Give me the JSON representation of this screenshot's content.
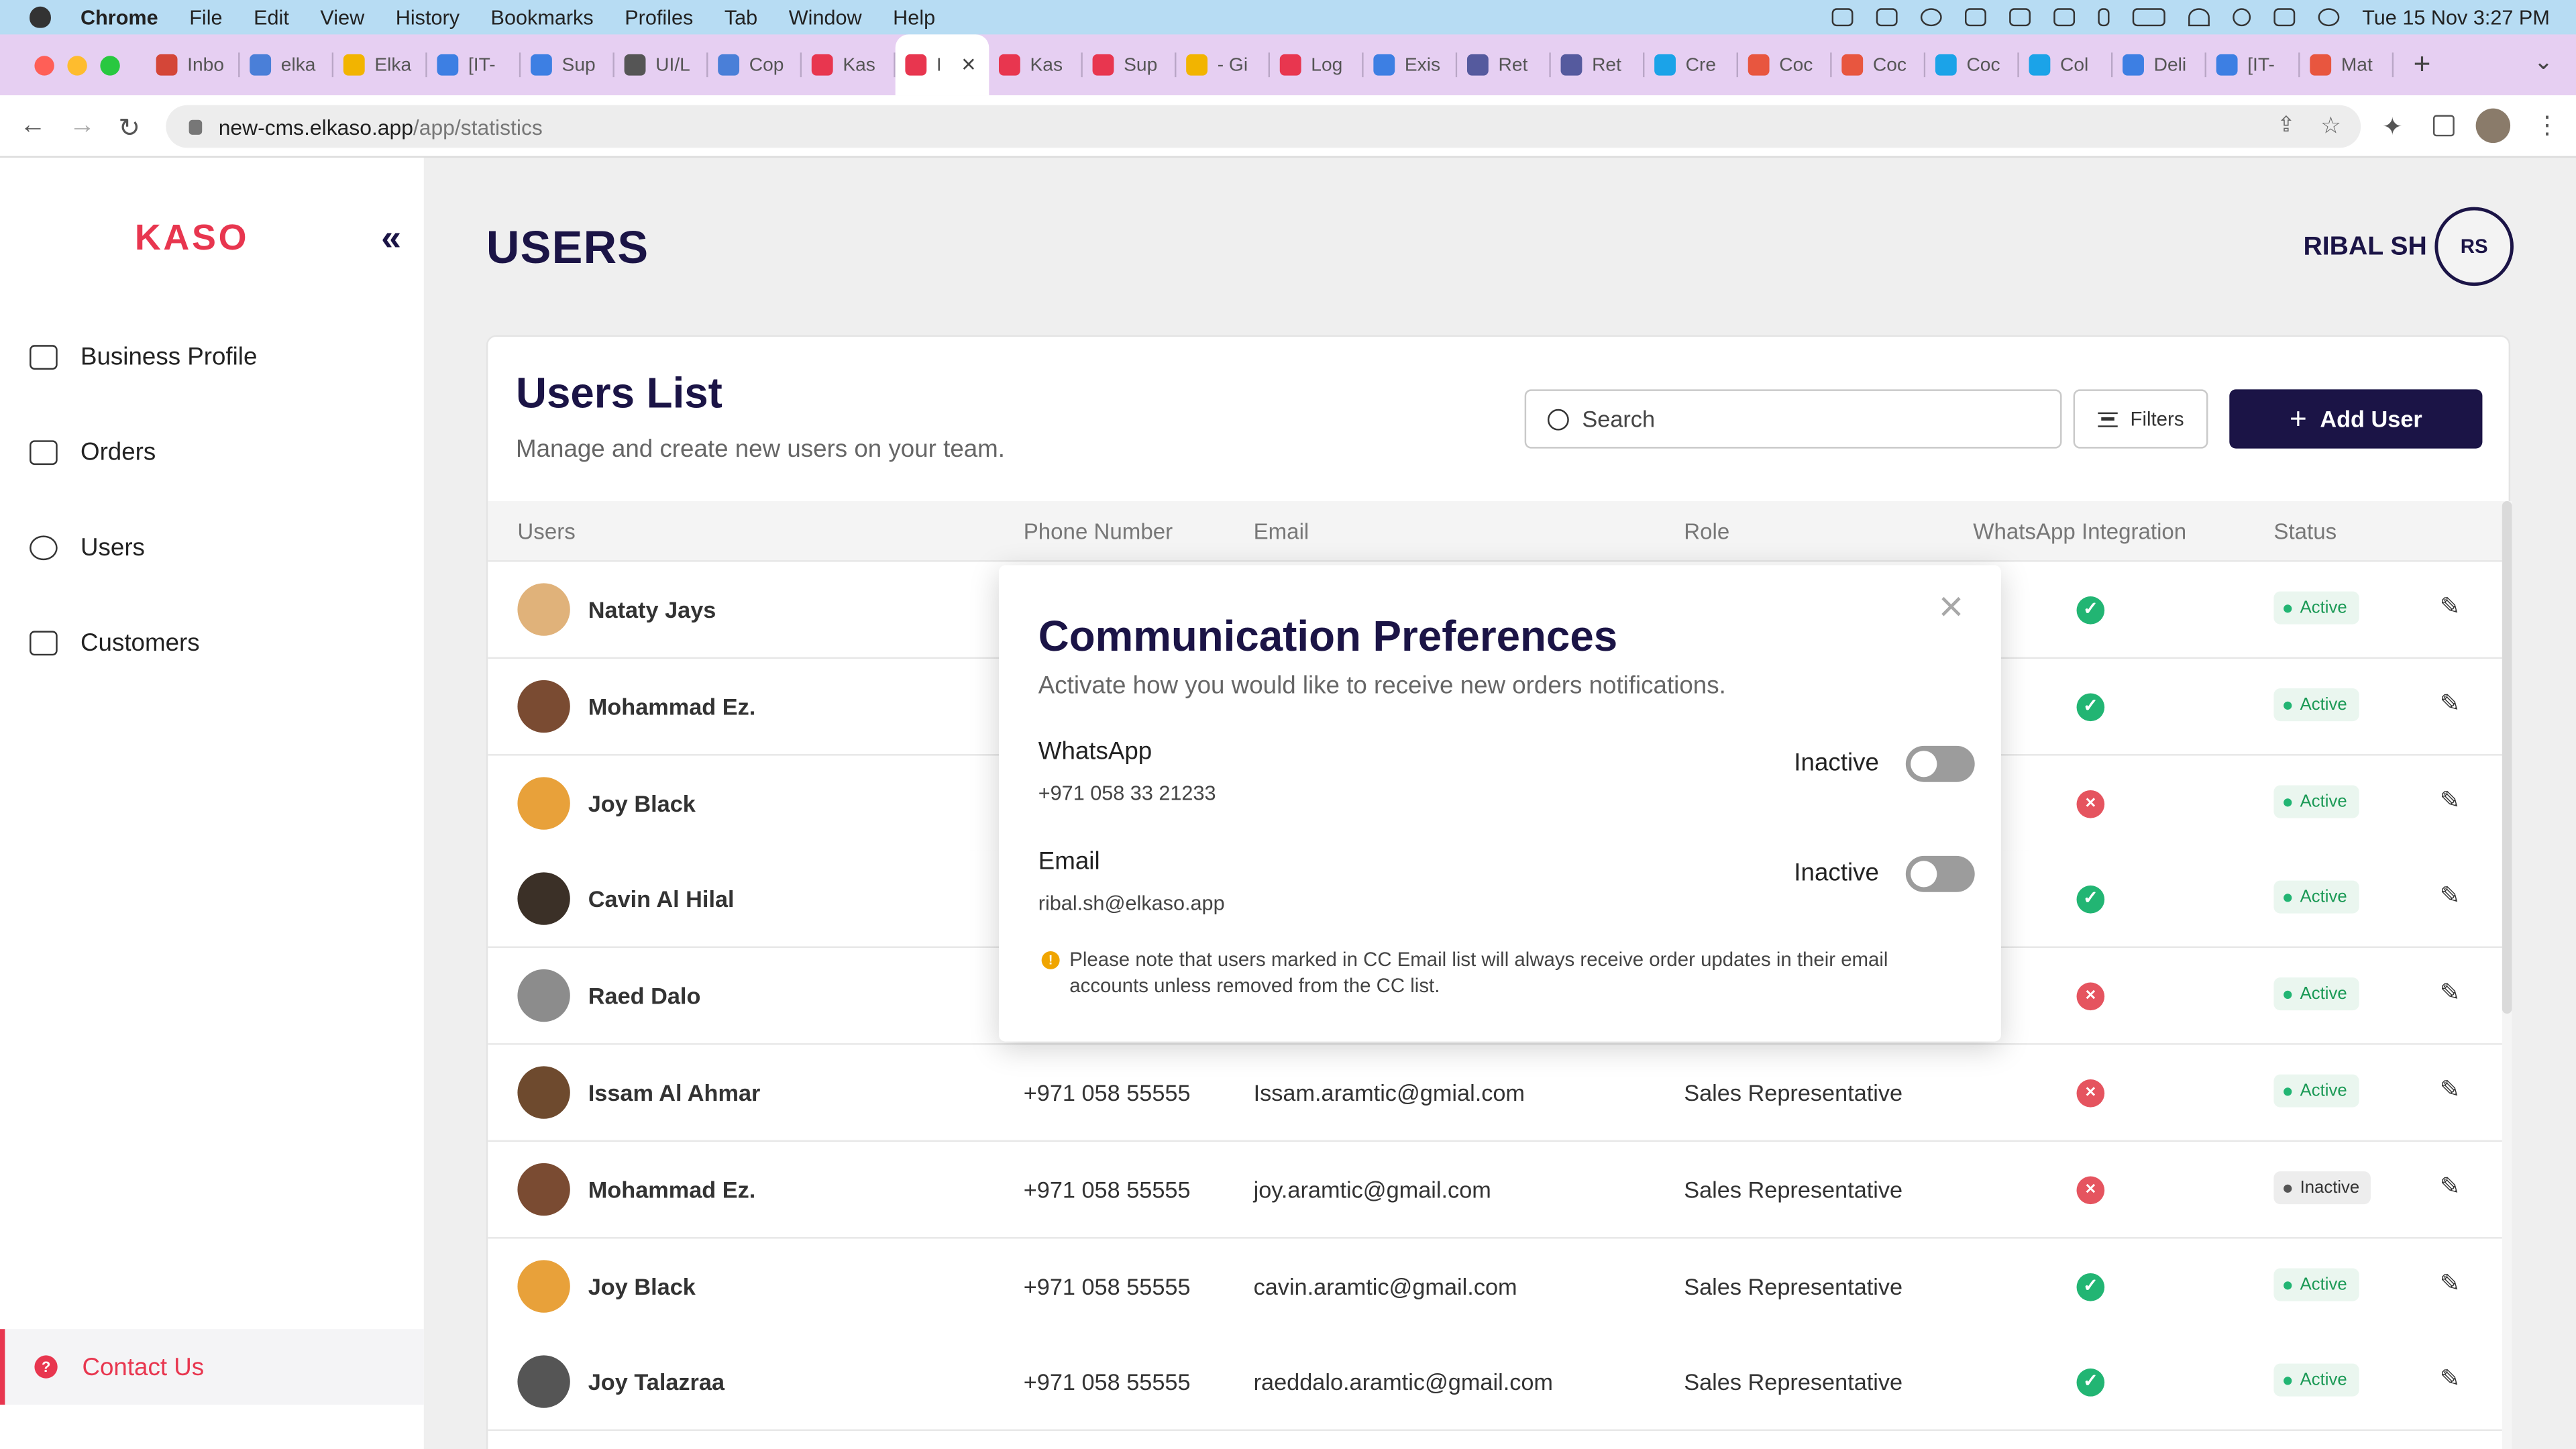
{
  "os_menubar": {
    "app": "Chrome",
    "menus": [
      "File",
      "Edit",
      "View",
      "History",
      "Bookmarks",
      "Profiles",
      "Tab",
      "Window",
      "Help"
    ],
    "clock": "Tue 15 Nov  3:27 PM"
  },
  "browser": {
    "tabs": [
      {
        "label": "Inbo",
        "color": "#d44638"
      },
      {
        "label": "elka",
        "color": "#4a7fd8"
      },
      {
        "label": "Elka",
        "color": "#f2b400"
      },
      {
        "label": "[IT-",
        "color": "#3d7fe3"
      },
      {
        "label": "Sup",
        "color": "#3d7fe3"
      },
      {
        "label": "UI/L",
        "color": "#555555"
      },
      {
        "label": "Cop",
        "color": "#4a7fd8"
      },
      {
        "label": "Kas",
        "color": "#e8364f"
      },
      {
        "label": "I",
        "color": "#e8364f",
        "active": true
      },
      {
        "label": "Kas",
        "color": "#e8364f"
      },
      {
        "label": "Sup",
        "color": "#e8364f"
      },
      {
        "label": "- Gi",
        "color": "#f2b400"
      },
      {
        "label": "Log",
        "color": "#e8364f"
      },
      {
        "label": "Exis",
        "color": "#3d7fe3"
      },
      {
        "label": "Ret",
        "color": "#555a9e"
      },
      {
        "label": "Ret",
        "color": "#555a9e"
      },
      {
        "label": "Cre",
        "color": "#1ba3e8"
      },
      {
        "label": "Coc",
        "color": "#e8563f"
      },
      {
        "label": "Coc",
        "color": "#e8563f"
      },
      {
        "label": "Coc",
        "color": "#1ba3e8"
      },
      {
        "label": "Col",
        "color": "#1ba3e8"
      },
      {
        "label": "Deli",
        "color": "#3d7fe3"
      },
      {
        "label": "[IT-",
        "color": "#3d7fe3"
      },
      {
        "label": "Mat",
        "color": "#e8563f"
      }
    ],
    "url_domain": "new-cms.elkaso.app",
    "url_path": "/app/statistics"
  },
  "sidebar": {
    "logo": "KASO",
    "collapse_icon": "«",
    "items": [
      {
        "label": "Business Profile",
        "icon": "store-icon"
      },
      {
        "label": "Orders",
        "icon": "briefcase-icon"
      },
      {
        "label": "Users",
        "icon": "users-icon"
      },
      {
        "label": "Customers",
        "icon": "customers-icon"
      }
    ],
    "contact": "Contact Us"
  },
  "header": {
    "title": "USERS",
    "user_name": "RIBAL SH",
    "user_initials": "RS"
  },
  "users_list": {
    "title": "Users List",
    "subtitle": "Manage and create new users on your team.",
    "search_placeholder": "Search",
    "filters_label": "Filters",
    "add_label": "Add User",
    "columns": [
      "Users",
      "Phone Number",
      "Email",
      "Role",
      "WhatsApp Integration",
      "Status"
    ],
    "rows": [
      {
        "name": "Nataty Jays",
        "phone": "",
        "email": "",
        "role": "",
        "whatsapp": true,
        "status": "Active",
        "avatar": "#e0b27a"
      },
      {
        "name": "Mohammad Ez.",
        "phone": "",
        "email": "",
        "role": "",
        "whatsapp": true,
        "status": "Active",
        "avatar": "#7a4b32"
      },
      {
        "name": "Joy Black",
        "phone": "",
        "email": "",
        "role": "",
        "whatsapp": false,
        "status": "Active",
        "avatar": "#e8a13a"
      },
      {
        "name": "Cavin Al Hilal",
        "phone": "",
        "email": "",
        "role": "",
        "whatsapp": true,
        "status": "Active",
        "avatar": "#3b3027"
      },
      {
        "name": "Raed Dalo",
        "phone": "",
        "email": "",
        "role": "",
        "whatsapp": false,
        "status": "Active",
        "avatar": "#8c8c8c"
      },
      {
        "name": "Issam Al Ahmar",
        "phone": "+971 058 55555",
        "email": "Issam.aramtic@gmial.com",
        "role": "Sales Representative",
        "whatsapp": false,
        "status": "Active",
        "avatar": "#6e4a2e"
      },
      {
        "name": "Mohammad Ez.",
        "phone": "+971 058 55555",
        "email": "joy.aramtic@gmail.com",
        "role": "Sales Representative",
        "whatsapp": false,
        "status": "Inactive",
        "avatar": "#7a4b32"
      },
      {
        "name": "Joy Black",
        "phone": "+971 058 55555",
        "email": "cavin.aramtic@gmail.com",
        "role": "Sales Representative",
        "whatsapp": true,
        "status": "Active",
        "avatar": "#e8a13a"
      },
      {
        "name": "Joy Talazraa",
        "phone": "+971 058 55555",
        "email": "raeddalo.aramtic@gmail.com",
        "role": "Sales Representative",
        "whatsapp": true,
        "status": "Active",
        "avatar": "#555555"
      }
    ]
  },
  "modal": {
    "title": "Communication Preferences",
    "subtitle": "Activate how you would like to receive new orders notifications.",
    "whatsapp_label": "WhatsApp",
    "whatsapp_value": "+971 058 33 21233",
    "whatsapp_state": "Inactive",
    "email_label": "Email",
    "email_value": "ribal.sh@elkaso.app",
    "email_state": "Inactive",
    "note": "Please note that users marked in CC Email list will always receive order updates in their email accounts unless removed from the CC list."
  },
  "colors": {
    "brand": "#e8364f",
    "navy": "#1b1446",
    "success": "#22b573",
    "danger": "#e5545f"
  }
}
